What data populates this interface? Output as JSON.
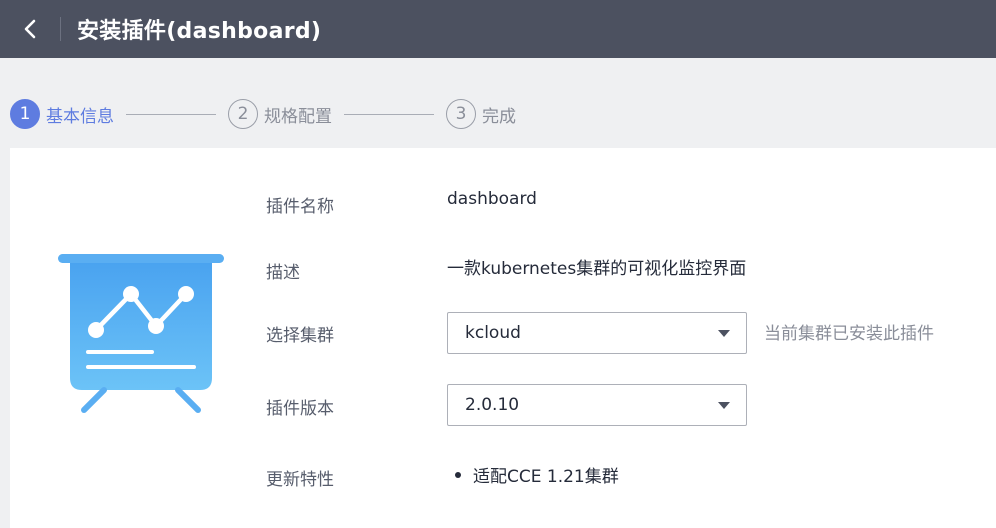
{
  "header": {
    "back_icon": "chevron-left-icon",
    "title": "安装插件(dashboard)"
  },
  "steps": [
    {
      "num": "1",
      "label": "基本信息",
      "active": true
    },
    {
      "num": "2",
      "label": "规格配置",
      "active": false
    },
    {
      "num": "3",
      "label": "完成",
      "active": false
    }
  ],
  "form": {
    "plugin_name_label": "插件名称",
    "plugin_name": "dashboard",
    "desc_label": "描述",
    "desc": "一款kubernetes集群的可视化监控界面",
    "cluster_label": "选择集群",
    "cluster_value": "kcloud",
    "cluster_hint": "当前集群已安装此插件",
    "version_label": "插件版本",
    "version_value": "2.0.10",
    "features_label": "更新特性",
    "features": [
      "适配CCE 1.21集群"
    ]
  },
  "illustration_icon": "presentation-chart-icon",
  "colors": {
    "topbar": "#4c5160",
    "accent": "#5e7ce0",
    "illustration": "#5aaef2"
  }
}
